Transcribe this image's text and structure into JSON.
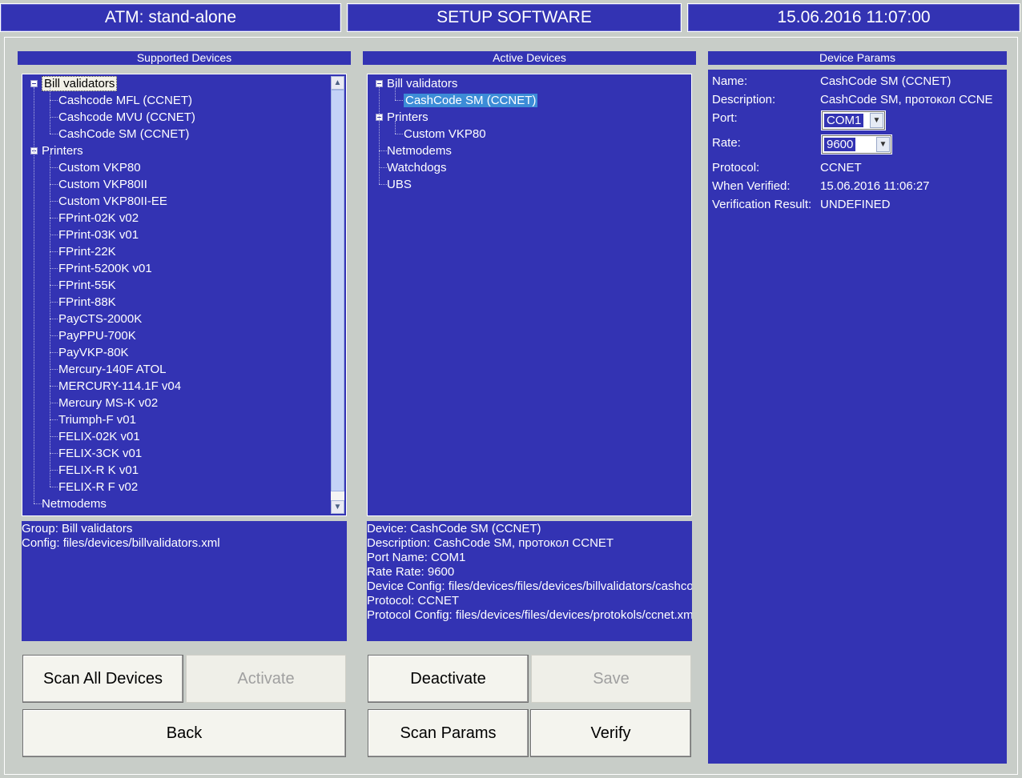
{
  "header": {
    "mode": "ATM: stand-alone",
    "title": "SETUP SOFTWARE",
    "datetime": "15.06.2016 11:07:00"
  },
  "supported": {
    "title": "Supported Devices",
    "groups": [
      {
        "label": "Bill validators",
        "items": [
          "Cashcode MFL (CCNET)",
          "Cashcode MVU (CCNET)",
          "CashCode SM (CCNET)"
        ]
      },
      {
        "label": "Printers",
        "items": [
          "Custom VKP80",
          "Custom VKP80II",
          "Custom VKP80II-EE",
          "FPrint-02K v02",
          "FPrint-03K v01",
          "FPrint-22K",
          "FPrint-5200K v01",
          "FPrint-55K",
          "FPrint-88K",
          "PayCTS-2000K",
          "PayPPU-700K",
          "PayVKP-80K",
          "Mercury-140F ATOL",
          "MERCURY-114.1F v04",
          "Mercury MS-K v02",
          "Triumph-F v01",
          "FELIX-02K v01",
          "FELIX-3CK v01",
          "FELIX-R K v01",
          "FELIX-R F v02"
        ]
      },
      {
        "label": "Netmodems",
        "items": []
      }
    ],
    "info": [
      "Group: Bill validators",
      "Config: files/devices/billvalidators.xml"
    ]
  },
  "active": {
    "title": "Active Devices",
    "groups": [
      {
        "label": "Bill validators",
        "items": [
          "CashCode SM (CCNET)"
        ]
      },
      {
        "label": "Printers",
        "items": [
          "Custom VKP80"
        ]
      },
      {
        "label": "Netmodems",
        "items": []
      },
      {
        "label": "Watchdogs",
        "items": []
      },
      {
        "label": "UBS",
        "items": []
      }
    ],
    "info": [
      "Device: CashCode SM (CCNET)",
      "Description: CashCode SM, протокол CCNET",
      "Port Name: COM1",
      "Rate Rate: 9600",
      "Device Config: files/devices/files/devices/billvalidators/cashcode_sm.xml",
      "Protocol: CCNET",
      "Protocol Config: files/devices/files/devices/protokols/ccnet.xml"
    ]
  },
  "params": {
    "title": "Device Params",
    "name_label": "Name:",
    "name_value": "CashCode SM (CCNET)",
    "desc_label": "Description:",
    "desc_value": "CashCode SM, протокол CCNE",
    "port_label": "Port:",
    "port_value": "COM1",
    "rate_label": "Rate:",
    "rate_value": "9600",
    "protocol_label": "Protocol:",
    "protocol_value": "CCNET",
    "verified_label": "When Verified:",
    "verified_value": "15.06.2016 11:06:27",
    "result_label": "Verification Result:",
    "result_value": "UNDEFINED"
  },
  "buttons": {
    "scan_all": "Scan All Devices",
    "activate": "Activate",
    "back": "Back",
    "deactivate": "Deactivate",
    "save": "Save",
    "scan_params": "Scan Params",
    "verify": "Verify"
  },
  "colors": {
    "panel": "#3333b3",
    "background": "#c8cdc8",
    "selection": "#3c8cd7"
  }
}
